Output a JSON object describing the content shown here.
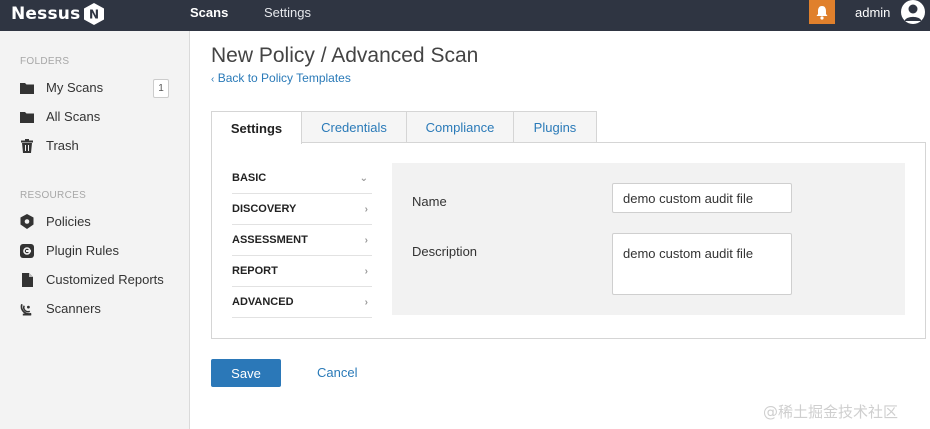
{
  "app": {
    "name": "Nessus",
    "logo_letter": "N"
  },
  "topnav": {
    "scans": "Scans",
    "settings": "Settings",
    "user": "admin"
  },
  "sidebar": {
    "folders_heading": "FOLDERS",
    "folders": [
      {
        "label": "My Scans",
        "icon": "folder-icon",
        "count": "1"
      },
      {
        "label": "All Scans",
        "icon": "folder-icon"
      },
      {
        "label": "Trash",
        "icon": "trash-icon"
      }
    ],
    "resources_heading": "RESOURCES",
    "resources": [
      {
        "label": "Policies",
        "icon": "shield-icon"
      },
      {
        "label": "Plugin Rules",
        "icon": "plugin-icon"
      },
      {
        "label": "Customized Reports",
        "icon": "report-icon"
      },
      {
        "label": "Scanners",
        "icon": "satellite-icon"
      }
    ]
  },
  "page": {
    "title": "New Policy / Advanced Scan",
    "back_link": "Back to Policy Templates"
  },
  "tabs": [
    {
      "label": "Settings",
      "active": true
    },
    {
      "label": "Credentials"
    },
    {
      "label": "Compliance"
    },
    {
      "label": "Plugins"
    }
  ],
  "settings_nav": [
    {
      "label": "BASIC",
      "expanded": true
    },
    {
      "label": "DISCOVERY"
    },
    {
      "label": "ASSESSMENT"
    },
    {
      "label": "REPORT"
    },
    {
      "label": "ADVANCED"
    }
  ],
  "form": {
    "name_label": "Name",
    "name_value": "demo custom audit file",
    "description_label": "Description",
    "description_value": "demo custom audit file"
  },
  "actions": {
    "save": "Save",
    "cancel": "Cancel"
  },
  "watermark": "@稀土掘金技术社区",
  "colors": {
    "topbar": "#2f3542",
    "accent": "#2b78b8",
    "notification": "#e0802c"
  }
}
